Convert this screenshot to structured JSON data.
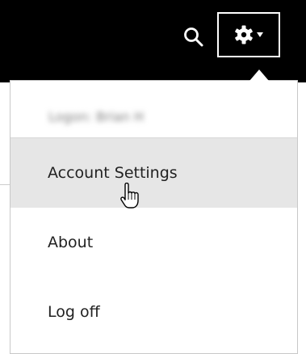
{
  "header": {
    "search_icon": "search-icon",
    "settings_icon": "gear-icon",
    "dropdown_icon": "caret-down-icon"
  },
  "menu": {
    "user_name": "Logon: Brian H",
    "items": [
      {
        "label": "Account Settings",
        "state": "hover"
      },
      {
        "label": "About"
      },
      {
        "label": "Log off"
      }
    ]
  },
  "colors": {
    "topbar": "#000000",
    "menu_bg": "#ffffff",
    "hover_bg": "#e6e6e6",
    "text": "#222222"
  },
  "cursor": "pointer-hand"
}
